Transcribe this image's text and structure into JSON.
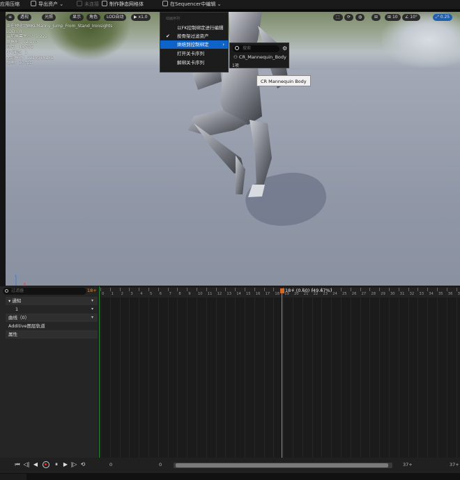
{
  "toolbar": {
    "apply_compression": "应用压缩",
    "export_asset": "导出资产 ⌄",
    "unnamed_dim": "未连接",
    "make_static_mesh": "制作静态网格体",
    "edit_in_sequencer": "在Sequencer中编辑 ⌄"
  },
  "viewport": {
    "menu_icon": "≡",
    "perspective": "透视",
    "lit": "光照",
    "show": "显示",
    "character": "角色",
    "lod_auto": "LOD自动",
    "play_speed": "x1.0",
    "right_buttons": [
      "",
      "",
      "10",
      "10",
      "10°",
      "0.25"
    ],
    "stats": [
      "正在预览动画KLManny_Jump_From_Stand_Ironsights",
      "LOD：0",
      "当前屏幕大小：1.222",
      "三角形：92,170",
      "顶点：48,705",
      "UV通道：1",
      "大约尺寸：121x91x181",
      "帧率：30 fps"
    ]
  },
  "context_menu": {
    "section": "动画序列",
    "items": [
      {
        "label": "以FK控制绑定进行编辑",
        "checked": false,
        "selected": false
      },
      {
        "label": "按骨架过滤资产",
        "checked": true,
        "selected": false
      },
      {
        "label": "烘焙到控制绑定",
        "checked": false,
        "selected": true,
        "submenu": true
      },
      {
        "label": "打开关卡序列",
        "checked": false,
        "selected": false
      },
      {
        "label": "解绑关卡序列",
        "checked": false,
        "selected": false
      }
    ],
    "check_glyph": "✔",
    "arrow_glyph": "›"
  },
  "submenu": {
    "search_placeholder": "搜索",
    "item": "CR_Mannequin_Body",
    "count": "1项",
    "tooltip": "CR Mannequin Body"
  },
  "tracks": {
    "search_placeholder": "过滤器",
    "frame_count": "18+",
    "rows": [
      {
        "label": "▾ 通知",
        "dropdown": "▾"
      },
      {
        "label": "1",
        "dropdown": "▾"
      },
      {
        "label": "曲线（0）",
        "dropdown": "▾"
      },
      {
        "label": "Additive图层轨道",
        "dropdown": ""
      },
      {
        "label": "属性",
        "dropdown": ""
      }
    ]
  },
  "timeline": {
    "playhead_label": "18+ (0.60) (49.67%)",
    "ticks": [
      "0",
      "1",
      "2",
      "3",
      "4",
      "5",
      "6",
      "7",
      "8",
      "9",
      "10",
      "11",
      "12",
      "13",
      "14",
      "15",
      "16",
      "17",
      "18",
      "19",
      "20",
      "21",
      "22",
      "23",
      "24",
      "25",
      "26",
      "27",
      "28",
      "29",
      "30",
      "31",
      "32",
      "33",
      "34",
      "35",
      "36",
      "37"
    ],
    "start_frame": "0",
    "current_frame_box": "0",
    "end_frame": "37+",
    "end_frame_right": "37+"
  },
  "transport": {
    "buttons": [
      "⏮",
      "◁|",
      "◀",
      "●",
      "⏸",
      "▶",
      "|▷",
      "⏭",
      "⟲"
    ]
  },
  "colors": {
    "accent": "#0e63c9",
    "playhead": "#d06a2a",
    "track_start": "#2a8a3a"
  }
}
